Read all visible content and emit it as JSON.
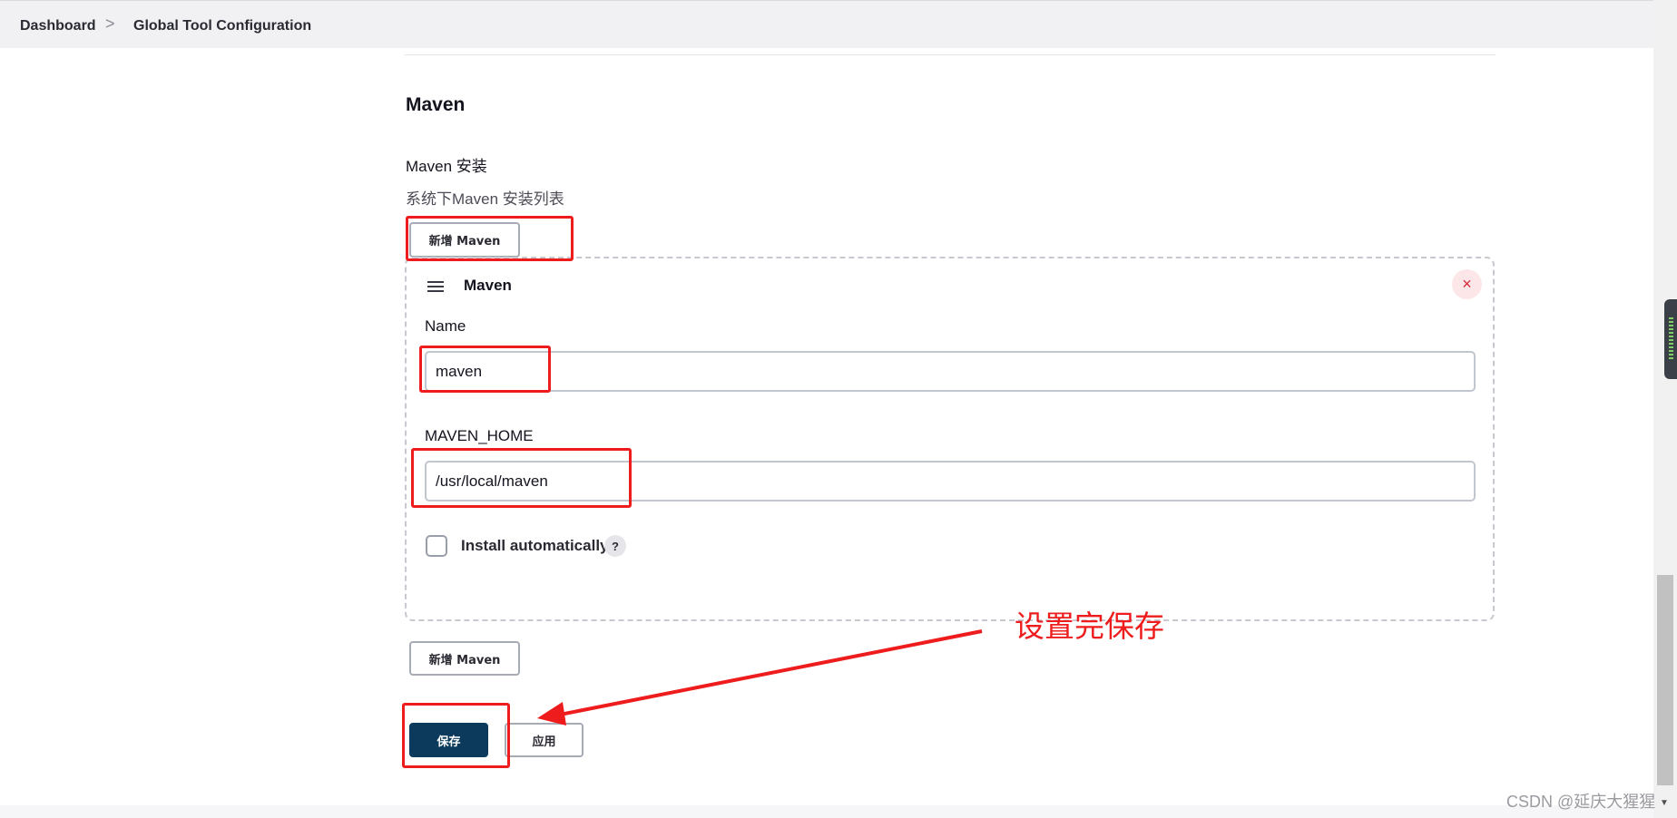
{
  "breadcrumb": {
    "items": [
      "Dashboard",
      "Global Tool Configuration"
    ],
    "separator": ">"
  },
  "section": {
    "title": "Maven",
    "install_label": "Maven 安装",
    "install_description": "系统下Maven 安装列表",
    "add_button_label": "新增 Maven"
  },
  "installation": {
    "title": "Maven",
    "name_label": "Name",
    "name_value": "maven",
    "home_label": "MAVEN_HOME",
    "home_value": "/usr/local/maven",
    "install_automatically_label": "Install automatically",
    "install_automatically_checked": false,
    "help_glyph": "?",
    "close_glyph": "×"
  },
  "actions": {
    "save_label": "保存",
    "apply_label": "应用"
  },
  "annotation": {
    "text": "设置完保存",
    "color": "#ee1c1c"
  },
  "watermark": "CSDN @延庆大猩猩",
  "colors": {
    "primary_button": "#0b3a5c",
    "close_icon": "#d42a3c",
    "breadcrumb_bg": "#f1f1f3"
  },
  "icons": {
    "drag_handle": "hamburger-icon",
    "close": "close-icon",
    "help": "help-icon",
    "breadcrumb_separator": "chevron-right-icon"
  }
}
